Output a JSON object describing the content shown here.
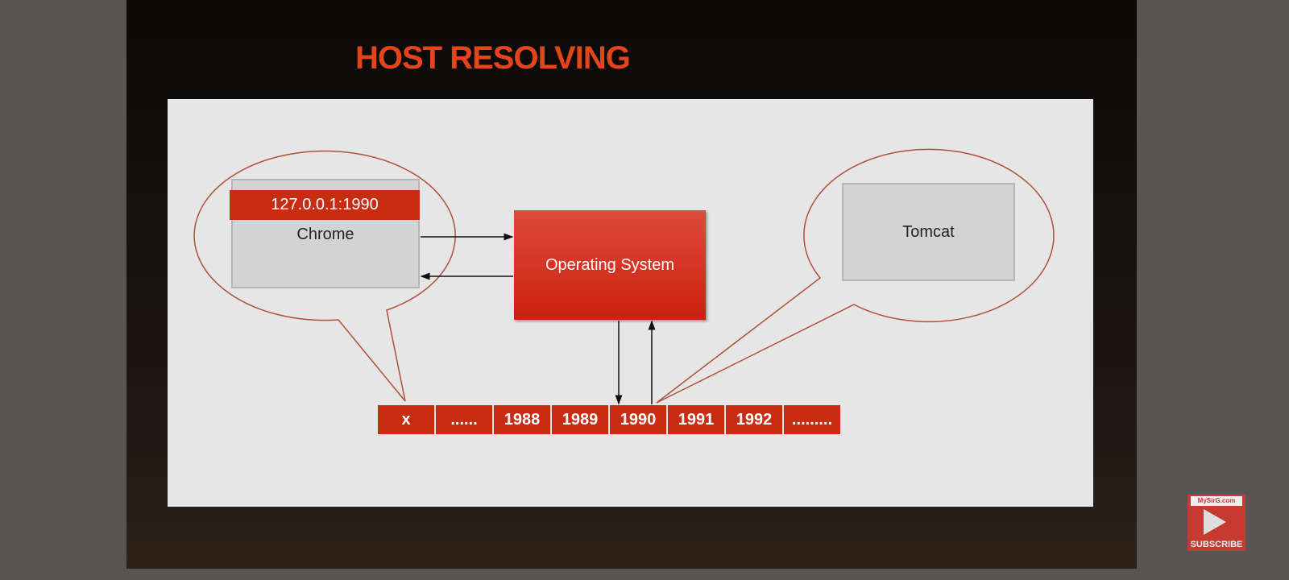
{
  "slide": {
    "title": "HOST RESOLVING",
    "client_address": "127.0.0.1:1990",
    "client_app": "Chrome",
    "os_label": "Operating System",
    "server_app": "Tomcat",
    "ports": [
      "x",
      "......",
      "1988",
      "1989",
      "1990",
      "1991",
      "1992",
      "........."
    ]
  },
  "overlay": {
    "subscribe_label": "SUBSCRIBE",
    "logo_text": "MySirG.com"
  },
  "colors": {
    "accent": "#e2441c",
    "box_red": "#c82d12",
    "panel": "#e6e6e6"
  }
}
